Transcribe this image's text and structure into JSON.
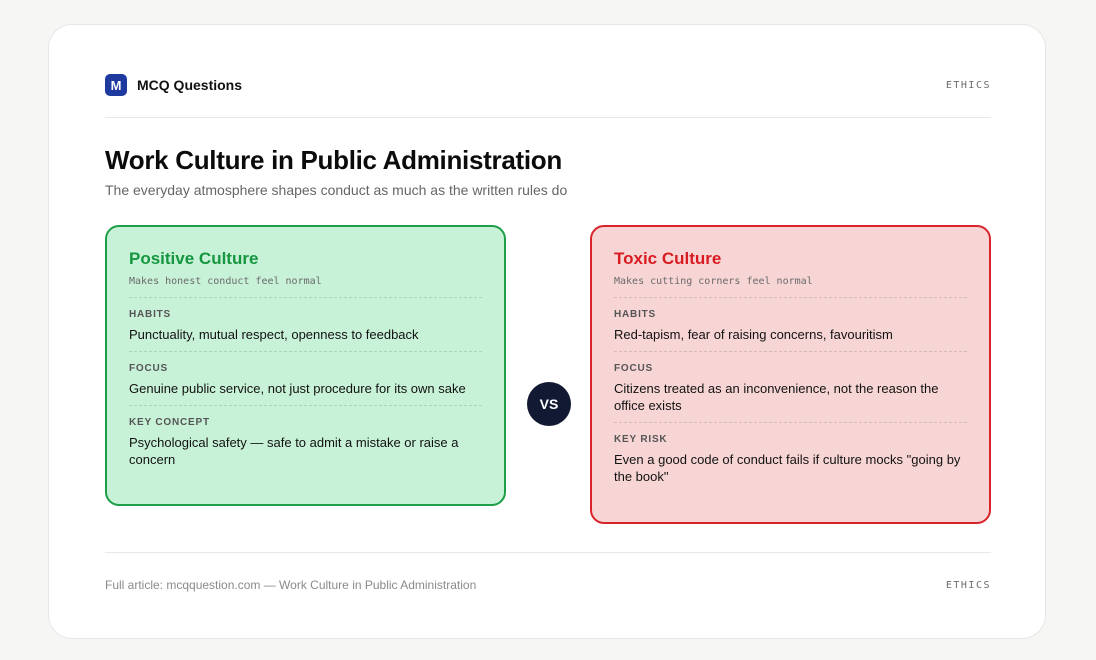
{
  "brand": {
    "logo_letter": "M",
    "name": "MCQ Questions"
  },
  "header": {
    "tag": "ETHICS"
  },
  "title": "Work Culture in Public Administration",
  "subtitle": "The everyday atmosphere shapes conduct as much as the written rules do",
  "positive": {
    "title": "Positive Culture",
    "subtitle": "Makes honest conduct feel normal",
    "sections": [
      {
        "label": "HABITS",
        "text": "Punctuality, mutual respect, openness to feedback"
      },
      {
        "label": "FOCUS",
        "text": "Genuine public service, not just procedure for its own sake"
      },
      {
        "label": "KEY CONCEPT",
        "text": "Psychological safety — safe to admit a mistake or raise a concern"
      }
    ]
  },
  "vs_label": "VS",
  "toxic": {
    "title": "Toxic Culture",
    "subtitle": "Makes cutting corners feel normal",
    "sections": [
      {
        "label": "HABITS",
        "text": "Red-tapism, fear of raising concerns, favouritism"
      },
      {
        "label": "FOCUS",
        "text": "Citizens treated as an inconvenience, not the reason the office exists"
      },
      {
        "label": "KEY RISK",
        "text": "Even a good code of conduct fails if culture mocks \"going by the book\""
      }
    ]
  },
  "footer": {
    "text": "Full article: mcqquestion.com — Work Culture in Public Administration",
    "tag": "ETHICS"
  },
  "colors": {
    "brand_blue": "#1e3a9e",
    "positive_accent": "#16963f",
    "positive_bg": "#c8f2d8",
    "toxic_accent": "#d91c22",
    "toxic_bg": "#f8d5d5",
    "vs_bg": "#121a33"
  }
}
